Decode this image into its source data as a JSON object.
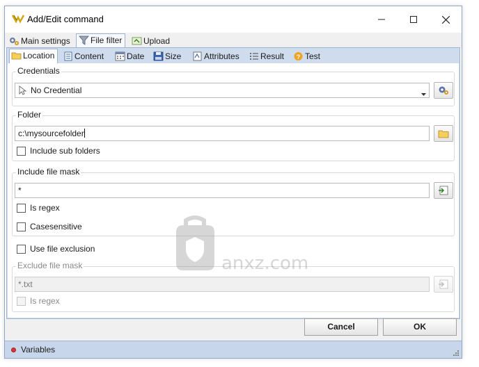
{
  "window": {
    "title": "Add/Edit command"
  },
  "main_tabs": [
    {
      "label": "Main settings",
      "icon": "gears-icon"
    },
    {
      "label": "File filter",
      "icon": "filter-icon",
      "active": true
    },
    {
      "label": "Upload",
      "icon": "upload-icon"
    }
  ],
  "sub_tabs": [
    {
      "label": "Location",
      "icon": "folder-icon",
      "active": true
    },
    {
      "label": "Content",
      "icon": "document-icon"
    },
    {
      "label": "Date",
      "icon": "calendar-icon"
    },
    {
      "label": "Size",
      "icon": "disk-icon"
    },
    {
      "label": "Attributes",
      "icon": "attributes-icon"
    },
    {
      "label": "Result",
      "icon": "list-icon"
    },
    {
      "label": "Test",
      "icon": "help-icon"
    }
  ],
  "credentials": {
    "label": "Credentials",
    "value": "No Credential"
  },
  "folder": {
    "label": "Folder",
    "value": "c:\\mysourcefolder",
    "include_sub_label": "Include sub folders",
    "include_sub_checked": false
  },
  "include_mask": {
    "label": "Include file mask",
    "value": "*",
    "is_regex_label": "Is regex",
    "case_label": "Casesensitive"
  },
  "exclusion": {
    "use_label": "Use file exclusion",
    "use_checked": false
  },
  "exclude_mask": {
    "label": "Exclude file mask",
    "value": "*.txt",
    "is_regex_label": "Is regex"
  },
  "buttons": {
    "cancel": "Cancel",
    "ok": "OK"
  },
  "status": {
    "text": "Variables"
  },
  "watermark": {
    "text": "anxz.com"
  },
  "colors": {
    "panel_bg": "#cfdcee",
    "accent_border": "#9eb3cf",
    "status_dot": "#e0303a"
  }
}
